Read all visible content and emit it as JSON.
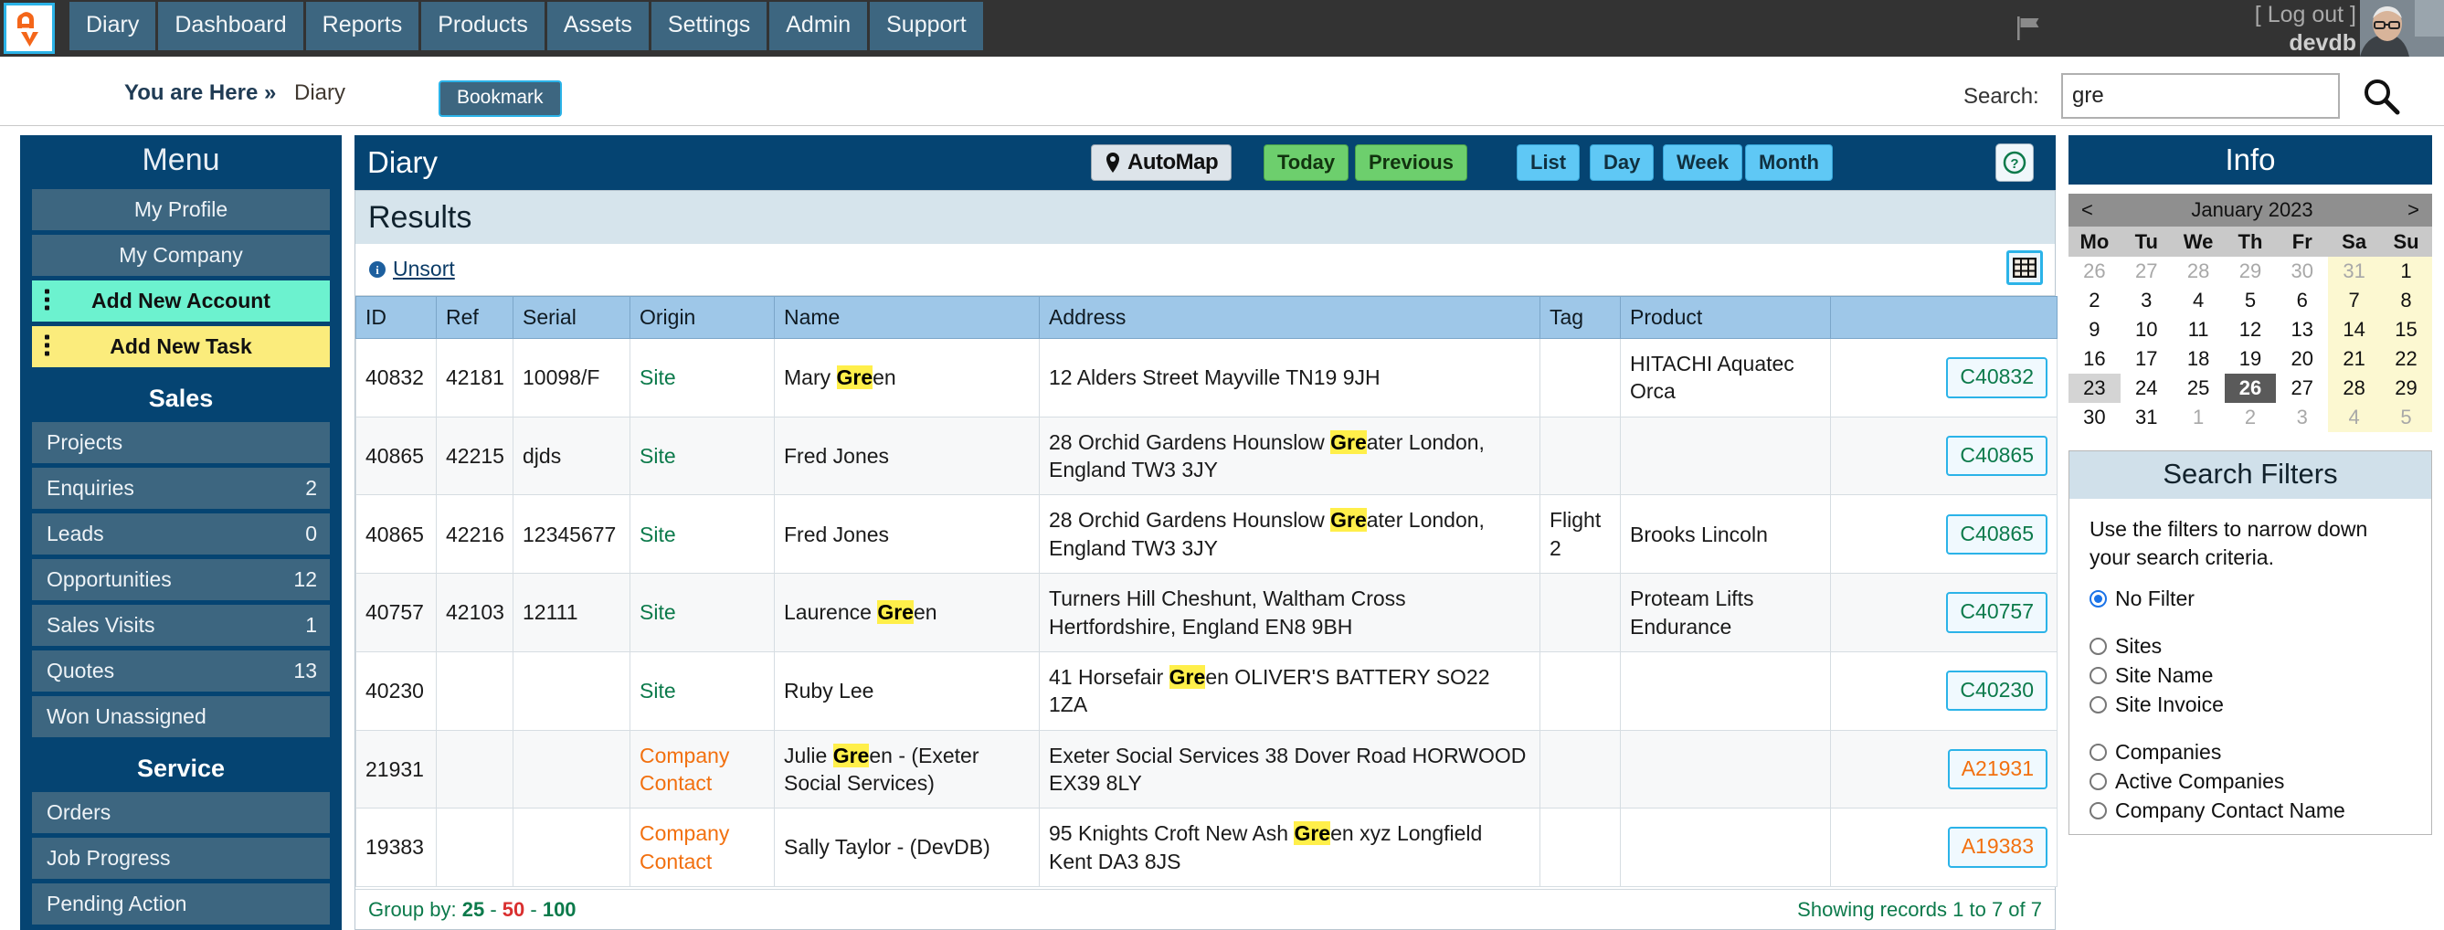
{
  "topnav": {
    "logo_alt": "app-logo",
    "tabs": [
      {
        "label": "Diary"
      },
      {
        "label": "Dashboard"
      },
      {
        "label": "Reports"
      },
      {
        "label": "Products"
      },
      {
        "label": "Assets"
      },
      {
        "label": "Settings"
      },
      {
        "label": "Admin"
      },
      {
        "label": "Support"
      }
    ],
    "logout": "[ Log out ]",
    "username": "devdb"
  },
  "crumb": {
    "here": "You are Here »",
    "page": "Diary",
    "bookmark": "Bookmark"
  },
  "search": {
    "label": "Search:",
    "value": "gre",
    "placeholder": ""
  },
  "menu": {
    "title": "Menu",
    "items": [
      {
        "label": "My Profile",
        "badge": "",
        "style": "plain"
      },
      {
        "label": "My Company",
        "badge": "",
        "style": "plain"
      },
      {
        "label": "Add New Account",
        "badge": "",
        "style": "green"
      },
      {
        "label": "Add New Task",
        "badge": "",
        "style": "yellow"
      }
    ],
    "section_sales": "Sales",
    "sales_items": [
      {
        "label": "Projects",
        "badge": ""
      },
      {
        "label": "Enquiries",
        "badge": "2"
      },
      {
        "label": "Leads",
        "badge": "0"
      },
      {
        "label": "Opportunities",
        "badge": "12"
      },
      {
        "label": "Sales Visits",
        "badge": "1"
      },
      {
        "label": "Quotes",
        "badge": "13"
      },
      {
        "label": "Won Unassigned",
        "badge": ""
      }
    ],
    "section_service": "Service",
    "service_items": [
      {
        "label": "Orders",
        "badge": ""
      },
      {
        "label": "Job Progress",
        "badge": ""
      },
      {
        "label": "Pending Action",
        "badge": ""
      }
    ]
  },
  "diary": {
    "title": "Diary",
    "automap": "AutoMap",
    "today": "Today",
    "previous": "Previous",
    "list": "List",
    "day": "Day",
    "week": "Week",
    "month": "Month",
    "help": "?"
  },
  "results": {
    "heading": "Results",
    "unsort": "Unsort",
    "columns": [
      "ID",
      "Ref",
      "Serial",
      "Origin",
      "Name",
      "Address",
      "Tag",
      "Product",
      ""
    ],
    "rows": [
      {
        "id": "40832",
        "ref": "42181",
        "serial": "10098/F",
        "origin": "Site",
        "origin_type": "site",
        "name_pre": "Mary ",
        "name_hl": "Gre",
        "name_post": "en",
        "address_pre": "12 Alders Street Mayville TN19 9JH",
        "address_hl": "",
        "address_post": "",
        "tag": "",
        "product": "HITACHI Aquatec Orca",
        "action": "C40832",
        "action_type": "c"
      },
      {
        "id": "40865",
        "ref": "42215",
        "serial": "djds",
        "origin": "Site",
        "origin_type": "site",
        "name_pre": "Fred Jones",
        "name_hl": "",
        "name_post": "",
        "address_pre": "28 Orchid Gardens Hounslow ",
        "address_hl": "Gre",
        "address_post": "ater London, England TW3 3JY",
        "tag": "",
        "product": "",
        "action": "C40865",
        "action_type": "c"
      },
      {
        "id": "40865",
        "ref": "42216",
        "serial": "12345677",
        "origin": "Site",
        "origin_type": "site",
        "name_pre": "Fred Jones",
        "name_hl": "",
        "name_post": "",
        "address_pre": "28 Orchid Gardens Hounslow ",
        "address_hl": "Gre",
        "address_post": "ater London, England TW3 3JY",
        "tag": "Flight 2",
        "product": "Brooks Lincoln",
        "action": "C40865",
        "action_type": "c"
      },
      {
        "id": "40757",
        "ref": "42103",
        "serial": "12111",
        "origin": "Site",
        "origin_type": "site",
        "name_pre": "Laurence ",
        "name_hl": "Gre",
        "name_post": "en",
        "address_pre": "Turners Hill Cheshunt, Waltham Cross Hertfordshire, England EN8 9BH",
        "address_hl": "",
        "address_post": "",
        "tag": "",
        "product": "Proteam Lifts Endurance",
        "action": "C40757",
        "action_type": "c"
      },
      {
        "id": "40230",
        "ref": "",
        "serial": "",
        "origin": "Site",
        "origin_type": "site",
        "name_pre": "Ruby Lee",
        "name_hl": "",
        "name_post": "",
        "address_pre": "41 Horsefair ",
        "address_hl": "Gre",
        "address_post": "en OLIVER'S BATTERY SO22 1ZA",
        "tag": "",
        "product": "",
        "action": "C40230",
        "action_type": "c"
      },
      {
        "id": "21931",
        "ref": "",
        "serial": "",
        "origin": "Company Contact",
        "origin_type": "company",
        "name_pre": "Julie ",
        "name_hl": "Gre",
        "name_post": "en - (Exeter Social Services)",
        "address_pre": "Exeter Social Services 38 Dover Road HORWOOD EX39 8LY",
        "address_hl": "",
        "address_post": "",
        "tag": "",
        "product": "",
        "action": "A21931",
        "action_type": "a"
      },
      {
        "id": "19383",
        "ref": "",
        "serial": "",
        "origin": "Company Contact",
        "origin_type": "company",
        "name_pre": "Sally Taylor - (DevDB)",
        "name_hl": "",
        "name_post": "",
        "address_pre": "95 Knights Croft New Ash ",
        "address_hl": "Gre",
        "address_post": "en xyz Longfield Kent DA3 8JS",
        "tag": "",
        "product": "",
        "action": "A19383",
        "action_type": "a"
      }
    ],
    "group_by_label": "Group by:",
    "group_by_options": [
      "25",
      "50",
      "100"
    ],
    "group_by_selected": "50",
    "showing": "Showing records 1 to 7 of 7"
  },
  "info": {
    "title": "Info",
    "calendar": {
      "prev": "<",
      "next": ">",
      "month": "January 2023",
      "daynames": [
        "Mo",
        "Tu",
        "We",
        "Th",
        "Fr",
        "Sa",
        "Su"
      ],
      "weeks": [
        [
          {
            "d": "26",
            "other": true
          },
          {
            "d": "27",
            "other": true
          },
          {
            "d": "28",
            "other": true
          },
          {
            "d": "29",
            "other": true
          },
          {
            "d": "30",
            "other": true
          },
          {
            "d": "31",
            "other": true,
            "weekend": true
          },
          {
            "d": "1",
            "weekend": true
          }
        ],
        [
          {
            "d": "2"
          },
          {
            "d": "3"
          },
          {
            "d": "4"
          },
          {
            "d": "5"
          },
          {
            "d": "6"
          },
          {
            "d": "7",
            "weekend": true
          },
          {
            "d": "8",
            "weekend": true
          }
        ],
        [
          {
            "d": "9"
          },
          {
            "d": "10"
          },
          {
            "d": "11"
          },
          {
            "d": "12"
          },
          {
            "d": "13"
          },
          {
            "d": "14",
            "weekend": true
          },
          {
            "d": "15",
            "weekend": true
          }
        ],
        [
          {
            "d": "16"
          },
          {
            "d": "17"
          },
          {
            "d": "18"
          },
          {
            "d": "19"
          },
          {
            "d": "20"
          },
          {
            "d": "21",
            "weekend": true
          },
          {
            "d": "22",
            "weekend": true
          }
        ],
        [
          {
            "d": "23",
            "selected": true
          },
          {
            "d": "24"
          },
          {
            "d": "25"
          },
          {
            "d": "26",
            "today": true
          },
          {
            "d": "27"
          },
          {
            "d": "28",
            "weekend": true
          },
          {
            "d": "29",
            "weekend": true
          }
        ],
        [
          {
            "d": "30"
          },
          {
            "d": "31"
          },
          {
            "d": "1",
            "other": true
          },
          {
            "d": "2",
            "other": true
          },
          {
            "d": "3",
            "other": true
          },
          {
            "d": "4",
            "other": true,
            "weekend": true
          },
          {
            "d": "5",
            "other": true,
            "weekend": true
          }
        ]
      ]
    },
    "filters": {
      "title": "Search Filters",
      "help": "Use the filters to narrow down your search criteria.",
      "options_group1": [
        {
          "label": "No Filter",
          "checked": true
        }
      ],
      "options_group2": [
        {
          "label": "Sites",
          "checked": false
        },
        {
          "label": "Site Name",
          "checked": false
        },
        {
          "label": "Site Invoice",
          "checked": false
        }
      ],
      "options_group3": [
        {
          "label": "Companies",
          "checked": false
        },
        {
          "label": "Active Companies",
          "checked": false
        },
        {
          "label": "Company Contact Name",
          "checked": false
        }
      ]
    }
  },
  "colors": {
    "nav_bg": "#333333",
    "nav_tab": "#3d6680",
    "panel_header": "#054472",
    "accent_cyan": "#2bb3e8",
    "accent_green": "#6cf2cf",
    "accent_yellow": "#fbec7c",
    "highlight": "#ffef4a",
    "origin_site": "#0c7a4b",
    "origin_company": "#f2700f",
    "table_header": "#9ec7e8"
  }
}
